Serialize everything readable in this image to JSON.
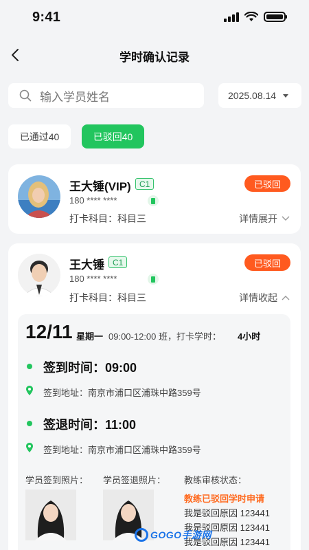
{
  "status_bar": {
    "time": "9:41"
  },
  "nav": {
    "title": "学时确认记录"
  },
  "search": {
    "placeholder": "输入学员姓名"
  },
  "date_filter": {
    "value": "2025.08.14"
  },
  "filters": {
    "passed": "已通过40",
    "rejected": "已驳回40"
  },
  "cards": [
    {
      "name": "王大锤(VIP)",
      "license": "C1",
      "phone": "180 **** ****",
      "subject": "打卡科目：科目三",
      "status": "已驳回",
      "toggle": "详情展开"
    },
    {
      "name": "王大锤",
      "license": "C1",
      "phone": "180 **** ****",
      "subject": "打卡科目：科目三",
      "status": "已驳回",
      "toggle": "详情收起",
      "detail": {
        "date": "12/11",
        "weekday": "星期一",
        "shift": "09:00-12:00 班，打卡学时：",
        "hours": "4小时",
        "checkin_time": "签到时间：09:00",
        "checkin_address": "签到地址：南京市浦口区浦珠中路359号",
        "checkout_time": "签退时间：11:00",
        "checkout_address": "签到地址：南京市浦口区浦珠中路359号",
        "checkin_photo_label": "学员签到照片：",
        "checkout_photo_label": "学员签退照片：",
        "review_label": "教练审核状态：",
        "review_status": "教练已驳回学时申请",
        "reasons": [
          "我是驳回原因 123441",
          "我是驳回原因 123441",
          "我是驳回原因 123441"
        ]
      }
    }
  ],
  "watermark": "GOGO手游网",
  "colors": {
    "accent": "#22c55e",
    "rejected": "#ff5a1f"
  }
}
